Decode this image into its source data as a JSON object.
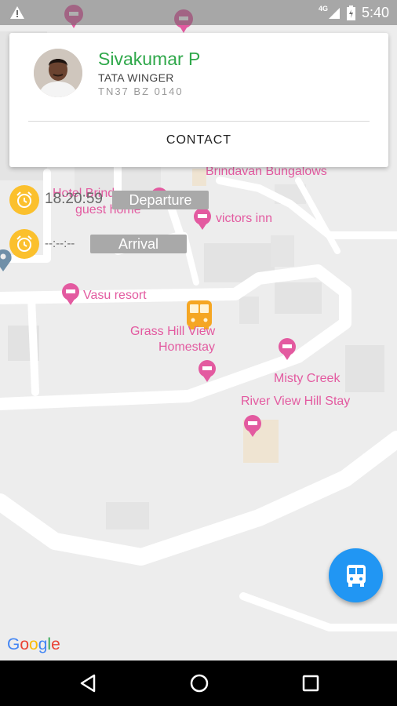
{
  "status_bar": {
    "network": "4G",
    "time": "5:40"
  },
  "driver_card": {
    "name": "Sivakumar P",
    "vehicle_model": "TATA WINGER",
    "plate_number": "TN37 BZ 0140",
    "contact_label": "CONTACT"
  },
  "timeline": {
    "departure_time": "18:20:59",
    "departure_label": "Departure",
    "arrival_time": "--:--:--",
    "arrival_label": "Arrival"
  },
  "map_labels": {
    "brindavan": "Brindavan Bungalows",
    "hotel_brind": "Hotel Brind",
    "guest_home": "guest home",
    "victors_inn": "victors inn",
    "vasu_resort": "Vasu resort",
    "grass_hill_1": "Grass Hill View",
    "grass_hill_2": "Homestay",
    "misty_creek": "Misty Creek",
    "river_view": "River View Hill Stay"
  },
  "google_logo": "Google",
  "colors": {
    "accent_green": "#2fa84a",
    "fab_blue": "#2196f3",
    "clock_yellow": "#fbc02d",
    "map_pink": "#e35aa0"
  }
}
